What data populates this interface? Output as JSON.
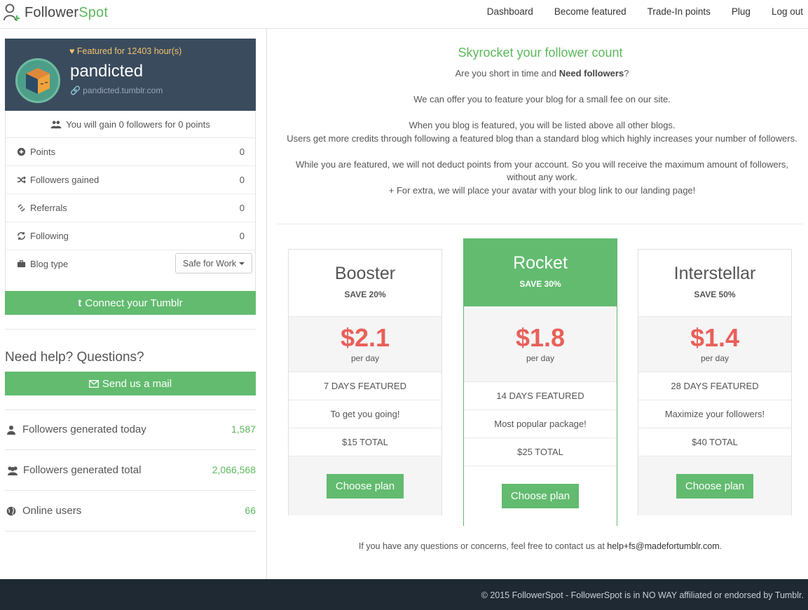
{
  "navbar": {
    "brand_prefix": "Follower",
    "brand_suffix": "Spot",
    "links": [
      "Dashboard",
      "Become featured",
      "Trade-In points",
      "Plug",
      "Log out"
    ]
  },
  "profile": {
    "featured": "Featured for 12403 hour(s)",
    "name": "pandicted",
    "url": "pandicted.tumblr.com"
  },
  "stats": {
    "gain_text": "You will gain 0 followers for 0 points",
    "rows": [
      {
        "label": "Points",
        "value": "0",
        "icon": "plus-circle-icon"
      },
      {
        "label": "Followers gained",
        "value": "0",
        "icon": "shuffle-icon"
      },
      {
        "label": "Referrals",
        "value": "0",
        "icon": "link-icon"
      },
      {
        "label": "Following",
        "value": "0",
        "icon": "refresh-icon"
      }
    ],
    "blog_type_label": "Blog type",
    "blog_type_value": "Safe for Work"
  },
  "connect_button": "Connect your Tumblr",
  "help": {
    "title": "Need help? Questions?",
    "mail_button": "Send us a mail"
  },
  "site_stats": [
    {
      "label": "Followers generated today",
      "value": "1,587",
      "icon": "user-icon"
    },
    {
      "label": "Followers generated total",
      "value": "2,066,568",
      "icon": "users-icon"
    },
    {
      "label": "Online users",
      "value": "66",
      "icon": "globe-icon"
    }
  ],
  "main": {
    "headline": "Skyrocket your follower count",
    "intro_q_prefix": "Are you short in time and ",
    "intro_q_bold": "Need followers",
    "intro_q_suffix": "?",
    "para1": "We can offer you to feature your blog for a small fee on our site.",
    "para2a": "When you blog is featured, you will be listed above all other blogs.",
    "para2b": "Users get more credits through following a featured blog than a standard blog which highly increases your number of followers.",
    "para3a": "While you are featured, we will not deduct points from your account. So you will receive the maximum amount of followers, without any work.",
    "para3b": "+ For extra, we will place your avatar with your blog link to our landing page!"
  },
  "plans": [
    {
      "name": "Booster",
      "save": "SAVE 20%",
      "price": "$2.1",
      "per": "per day",
      "days": "7 DAYS FEATURED",
      "tagline": "To get you going!",
      "total": "$15 TOTAL",
      "button": "Choose plan"
    },
    {
      "name": "Rocket",
      "save": "SAVE 30%",
      "price": "$1.8",
      "per": "per day",
      "days": "14 DAYS FEATURED",
      "tagline": "Most popular package!",
      "total": "$25 TOTAL",
      "button": "Choose plan"
    },
    {
      "name": "Interstellar",
      "save": "SAVE 50%",
      "price": "$1.4",
      "per": "per day",
      "days": "28 DAYS FEATURED",
      "tagline": "Maximize your followers!",
      "total": "$40 TOTAL",
      "button": "Choose plan"
    }
  ],
  "contact": {
    "text": "If you have any questions or concerns, feel free to contact us at ",
    "email": "help+fs@madefortumblr.com",
    "suffix": "."
  },
  "footer": {
    "text": "© 2015 FollowerSpot - FollowerSpot is in NO WAY affiliated or endorsed by Tumblr."
  },
  "colors": {
    "accent_green": "#62bb6f",
    "price_red": "#e9605a",
    "profile_bg": "#3a4b5e",
    "footer_bg": "#1f2933"
  }
}
